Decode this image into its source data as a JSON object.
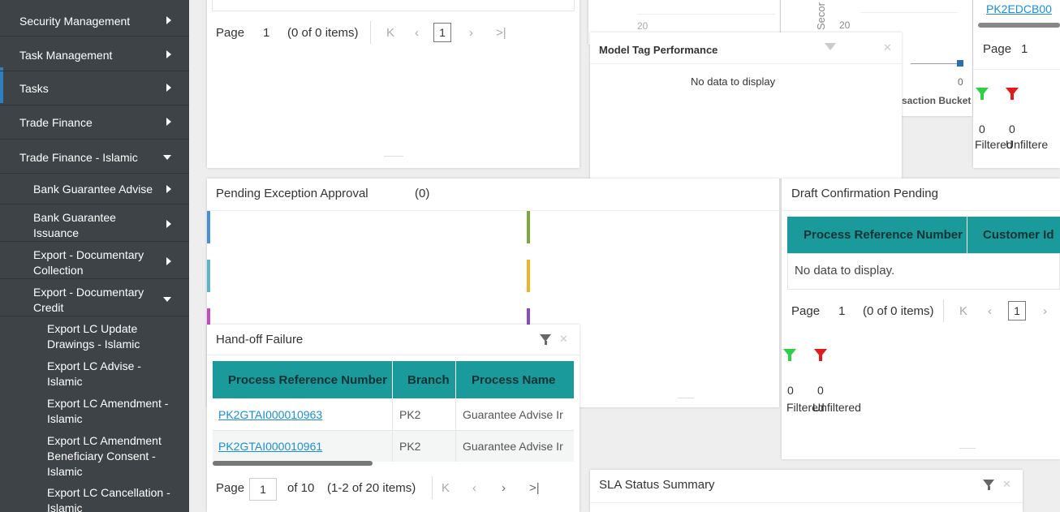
{
  "sidebar": {
    "items": [
      {
        "label": "Security Management",
        "arrow": "right"
      },
      {
        "label": "Task Management",
        "arrow": "right"
      },
      {
        "label": "Tasks",
        "arrow": "right"
      },
      {
        "label": "Trade Finance",
        "arrow": "right"
      },
      {
        "label": "Trade Finance - Islamic",
        "arrow": "down"
      }
    ],
    "sub_items": [
      {
        "line1": "Bank Guarantee Advise",
        "line2": "",
        "arrow": "right"
      },
      {
        "line1": "Bank Guarantee",
        "line2": "Issuance",
        "arrow": "right"
      },
      {
        "line1": "Export - Documentary",
        "line2": "Collection",
        "arrow": "right"
      },
      {
        "line1": "Export - Documentary",
        "line2": "Credit",
        "arrow": "down"
      }
    ],
    "sub_sub_items": [
      {
        "line1": "Export LC Update",
        "line2": "Drawings - Islamic",
        "line3": ""
      },
      {
        "line1": "Export LC Advise -",
        "line2": "Islamic",
        "line3": ""
      },
      {
        "line1": "Export LC Amendment -",
        "line2": "Islamic",
        "line3": ""
      },
      {
        "line1": "Export LC Amendment",
        "line2": "Beneficiary Consent -",
        "line3": "Islamic"
      },
      {
        "line1": "Export LC Cancellation -",
        "line2": "Islamic",
        "line3": ""
      }
    ]
  },
  "top_left_panel": {
    "page_label": "Page",
    "page_number": "1",
    "items_text": "(0 of 0 items)",
    "current_page": "1"
  },
  "model_tag": {
    "title": "Model Tag Performance",
    "empty_text": "No data to display",
    "axis_tick_a": "20",
    "axis_tick_b": "20",
    "axis_label_partial": "Secor",
    "zero_tick": "0",
    "x_label_partial": "saction Bucket"
  },
  "top_right_panel": {
    "link": "PK2EDCB00",
    "page_label": "Page",
    "page_number": "1",
    "filtered_count": "0",
    "unfiltered_count": "0",
    "filtered_label": "Filtered",
    "unfiltered_label": "Unfiltere"
  },
  "pending_exception": {
    "title": "Pending Exception Approval",
    "count": "(0)",
    "bar_colors": [
      "#4a90d9",
      "#7aa83a",
      "#5ab7c9",
      "#f0b323",
      "#c44bc4",
      "#8a4bc4"
    ]
  },
  "draft_confirmation": {
    "title": "Draft Confirmation Pending",
    "columns": [
      "Process Reference Number",
      "Customer Id"
    ],
    "empty_text": "No data to display.",
    "page_label": "Page",
    "page_number": "1",
    "items_text": "(0 of 0 items)",
    "current_page": "1",
    "filtered_count": "0",
    "unfiltered_count": "0",
    "filtered_label": "Filtered",
    "unfiltered_label": "Unfiltered"
  },
  "handoff_failure": {
    "title": "Hand-off Failure",
    "columns": [
      "Process Reference Number",
      "Branch",
      "Process Name"
    ],
    "rows": [
      {
        "ref": "PK2GTAI000010963",
        "branch": "PK2",
        "process": "Guarantee Advise Ir"
      },
      {
        "ref": "PK2GTAI000010961",
        "branch": "PK2",
        "process": "Guarantee Advise Ir"
      }
    ],
    "page_label": "Page",
    "page_input": "1",
    "of_text": "of 10",
    "items_text": "(1-2 of 20 items)"
  },
  "sla_status": {
    "title": "SLA Status Summary"
  },
  "colors": {
    "sidebar_bg": "#3d4347",
    "teal_header": "#1a9a9a",
    "link_blue": "#1a8fd8"
  }
}
